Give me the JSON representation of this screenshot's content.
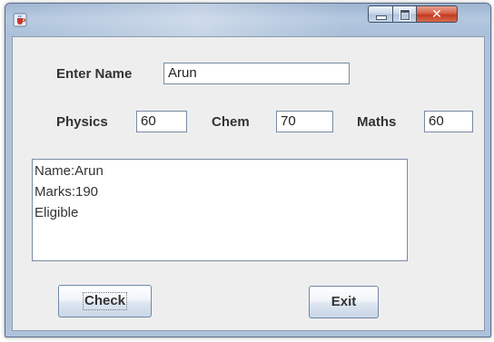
{
  "window": {
    "controls": {
      "minimize": "minimize",
      "maximize": "maximize",
      "close": "close"
    }
  },
  "form": {
    "name_label": "Enter Name",
    "name_value": "Arun",
    "physics_label": "Physics",
    "physics_value": "60",
    "chem_label": "Chem",
    "chem_value": "70",
    "maths_label": "Maths",
    "maths_value": "60"
  },
  "output": {
    "lines": [
      "Name:Arun",
      "Marks:190",
      "Eligible"
    ]
  },
  "buttons": {
    "check_label": "Check",
    "exit_label": "Exit"
  },
  "icons": {
    "app": "java-coffee-icon",
    "close": "close-icon",
    "minimize": "minimize-icon",
    "maximize": "maximize-icon"
  },
  "colors": {
    "client_background": "#eeeeee",
    "close_button": "#c23a20",
    "field_border": "#7a8aa4"
  }
}
